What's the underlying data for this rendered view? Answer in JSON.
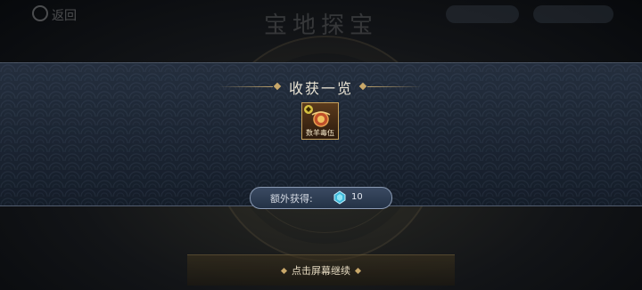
{
  "background": {
    "back_label": "返回",
    "title": "宝地探宝"
  },
  "reward_panel": {
    "title": "收获一览",
    "items": [
      {
        "name": "数羊毒伍",
        "icon": "dragon-orb-icon"
      }
    ],
    "extra": {
      "label": "额外获得:",
      "icon": "blue-gem-icon",
      "count": "10"
    }
  },
  "continue_hint": "点击屏幕继续",
  "colors": {
    "accent_gold": "#c9a86a",
    "banner_bg": "#1b2636"
  }
}
